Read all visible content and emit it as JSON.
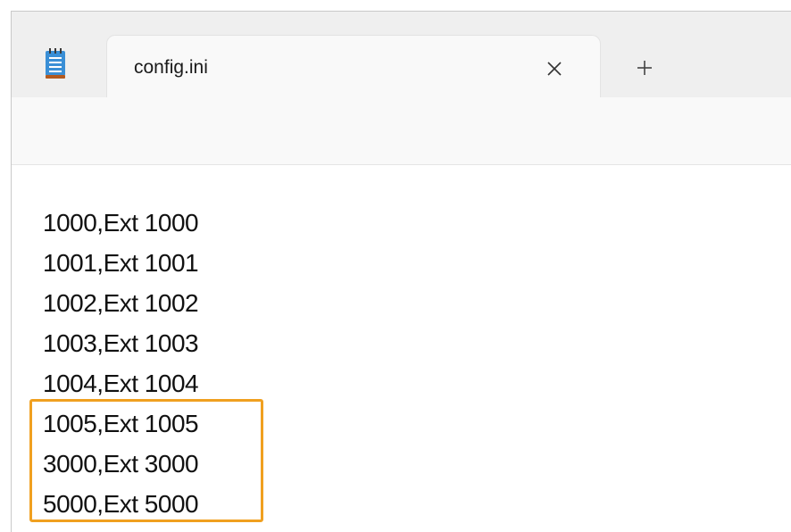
{
  "tab": {
    "title": "config.ini"
  },
  "icons": {
    "app": "notepad-icon",
    "close": "close-icon",
    "new_tab": "plus-icon"
  },
  "editor": {
    "lines": [
      "1000,Ext 1000",
      "1001,Ext 1001",
      "1002,Ext 1002",
      "1003,Ext 1003",
      "1004,Ext 1004",
      "1005,Ext 1005",
      "3000,Ext 3000",
      "5000,Ext 5000"
    ]
  },
  "colors": {
    "highlight": "#f0a020",
    "titlebar": "#efefef",
    "editor_background": "#ffffff"
  }
}
